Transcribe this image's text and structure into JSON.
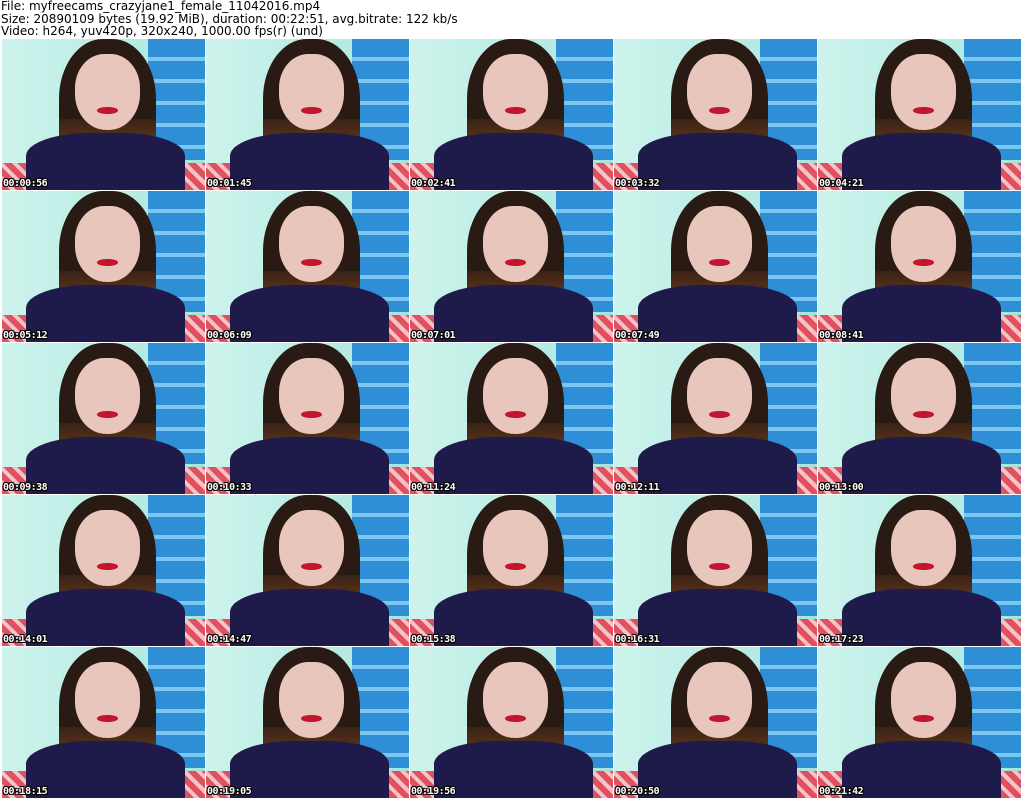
{
  "header": {
    "file_line": "File: myfreecams_crazyjane1_female_11042016.mp4",
    "size_line": "Size: 20890109 bytes (19.92 MiB), duration: 00:22:51, avg.bitrate: 122 kb/s",
    "video_line": "Video: h264, yuv420p, 320x240, 1000.00 fps(r) (und)"
  },
  "thumbnails": [
    {
      "timestamp": "00:00:56"
    },
    {
      "timestamp": "00:01:45"
    },
    {
      "timestamp": "00:02:41"
    },
    {
      "timestamp": "00:03:32"
    },
    {
      "timestamp": "00:04:21"
    },
    {
      "timestamp": "00:05:12"
    },
    {
      "timestamp": "00:06:09"
    },
    {
      "timestamp": "00:07:01"
    },
    {
      "timestamp": "00:07:49"
    },
    {
      "timestamp": "00:08:41"
    },
    {
      "timestamp": "00:09:38"
    },
    {
      "timestamp": "00:10:33"
    },
    {
      "timestamp": "00:11:24"
    },
    {
      "timestamp": "00:12:11"
    },
    {
      "timestamp": "00:13:00"
    },
    {
      "timestamp": "00:14:01"
    },
    {
      "timestamp": "00:14:47"
    },
    {
      "timestamp": "00:15:38"
    },
    {
      "timestamp": "00:16:31"
    },
    {
      "timestamp": "00:17:23"
    },
    {
      "timestamp": "00:18:15"
    },
    {
      "timestamp": "00:19:05"
    },
    {
      "timestamp": "00:19:56"
    },
    {
      "timestamp": "00:20:50"
    },
    {
      "timestamp": "00:21:42"
    }
  ]
}
